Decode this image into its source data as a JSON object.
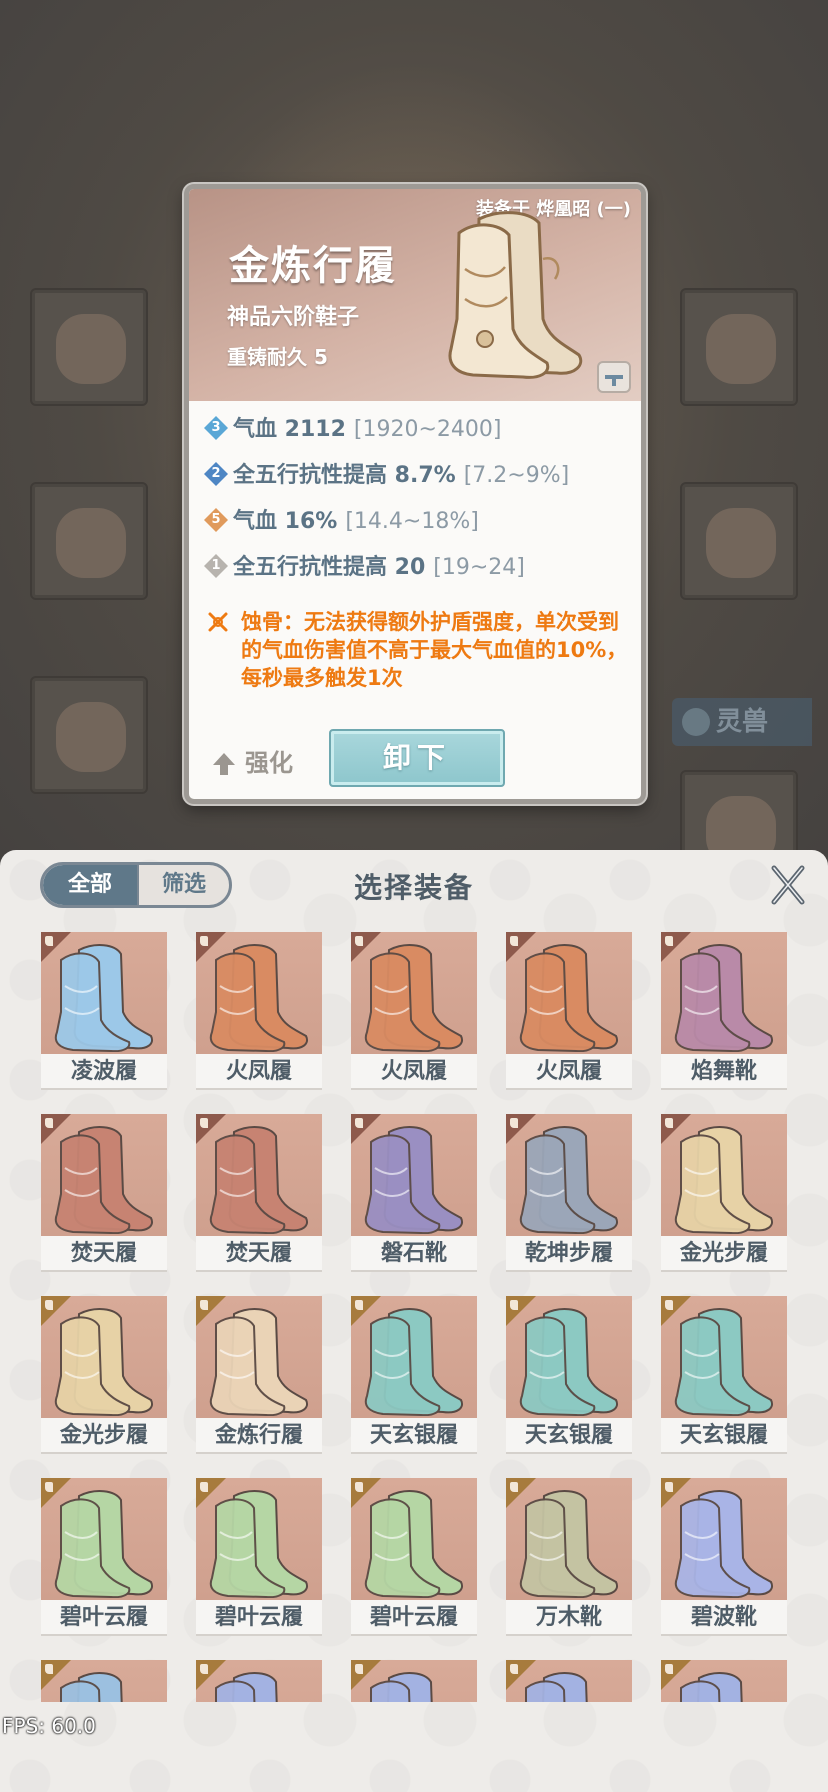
{
  "detail": {
    "equipped_by": "装备于 烨凰昭 (一)",
    "name": "金炼行履",
    "grade": "神品六阶鞋子",
    "durability": "重铸耐久 5",
    "stats": [
      {
        "badge": "3",
        "badge_color": "#5aa7d6",
        "text": "气血 2112",
        "range": "[1920~2400]"
      },
      {
        "badge": "2",
        "badge_color": "#4e86c4",
        "text": "全五行抗性提高 8.7%",
        "range": "[7.2~9%]"
      },
      {
        "badge": "5",
        "badge_color": "#e09a5c",
        "text": "气血 16%",
        "range": "[14.4~18%]"
      },
      {
        "badge": "1",
        "badge_color": "#b7b3ae",
        "text": "全五行抗性提高 20",
        "range": "[19~24]"
      }
    ],
    "special_effect": "蚀骨：无法获得额外护盾强度，单次受到的气血伤害值不高于最大气血值的10%，每秒最多触发1次",
    "strengthen_label": "强化",
    "unequip_label": "卸下"
  },
  "background": {
    "beast_tab_label": "灵兽"
  },
  "panel": {
    "tab_all": "全部",
    "tab_filter": "筛选",
    "title": "选择装备",
    "close_icon": "close-icon"
  },
  "grid": {
    "rows": [
      [
        {
          "name": "凌波履",
          "color": "#9cc8e8"
        },
        {
          "name": "火凤履",
          "color": "#d98b62"
        },
        {
          "name": "火凤履",
          "color": "#d98b62"
        },
        {
          "name": "火凤履",
          "color": "#d98b62"
        },
        {
          "name": "焰舞靴",
          "color": "#b98aa8"
        }
      ],
      [
        {
          "name": "焚天履",
          "color": "#c78372"
        },
        {
          "name": "焚天履",
          "color": "#c78372"
        },
        {
          "name": "磐石靴",
          "color": "#9a8fc2"
        },
        {
          "name": "乾坤步履",
          "color": "#9ba6b8"
        },
        {
          "name": "金光步履",
          "color": "#e7d2a6"
        }
      ],
      [
        {
          "name": "金光步履",
          "color": "#e7d2a6"
        },
        {
          "name": "金炼行履",
          "color": "#ead3b6"
        },
        {
          "name": "天玄银履",
          "color": "#8cc9c2"
        },
        {
          "name": "天玄银履",
          "color": "#8cc9c2"
        },
        {
          "name": "天玄银履",
          "color": "#8cc9c2"
        }
      ],
      [
        {
          "name": "碧叶云履",
          "color": "#b5d6a4"
        },
        {
          "name": "碧叶云履",
          "color": "#b5d6a4"
        },
        {
          "name": "碧叶云履",
          "color": "#b5d6a4"
        },
        {
          "name": "万木靴",
          "color": "#c4c3a2"
        },
        {
          "name": "碧波靴",
          "color": "#a9b4e6"
        }
      ],
      [
        {
          "name": "",
          "color": "#9cc0e0"
        },
        {
          "name": "",
          "color": "#a3b2e2"
        },
        {
          "name": "",
          "color": "#a3b2e2"
        },
        {
          "name": "",
          "color": "#a3b2e2"
        },
        {
          "name": "",
          "color": "#a3b2e2"
        }
      ]
    ],
    "corner_colors": [
      "red",
      "red",
      "gold",
      "gold",
      "gold"
    ]
  },
  "fps": "FPS: 60.0"
}
